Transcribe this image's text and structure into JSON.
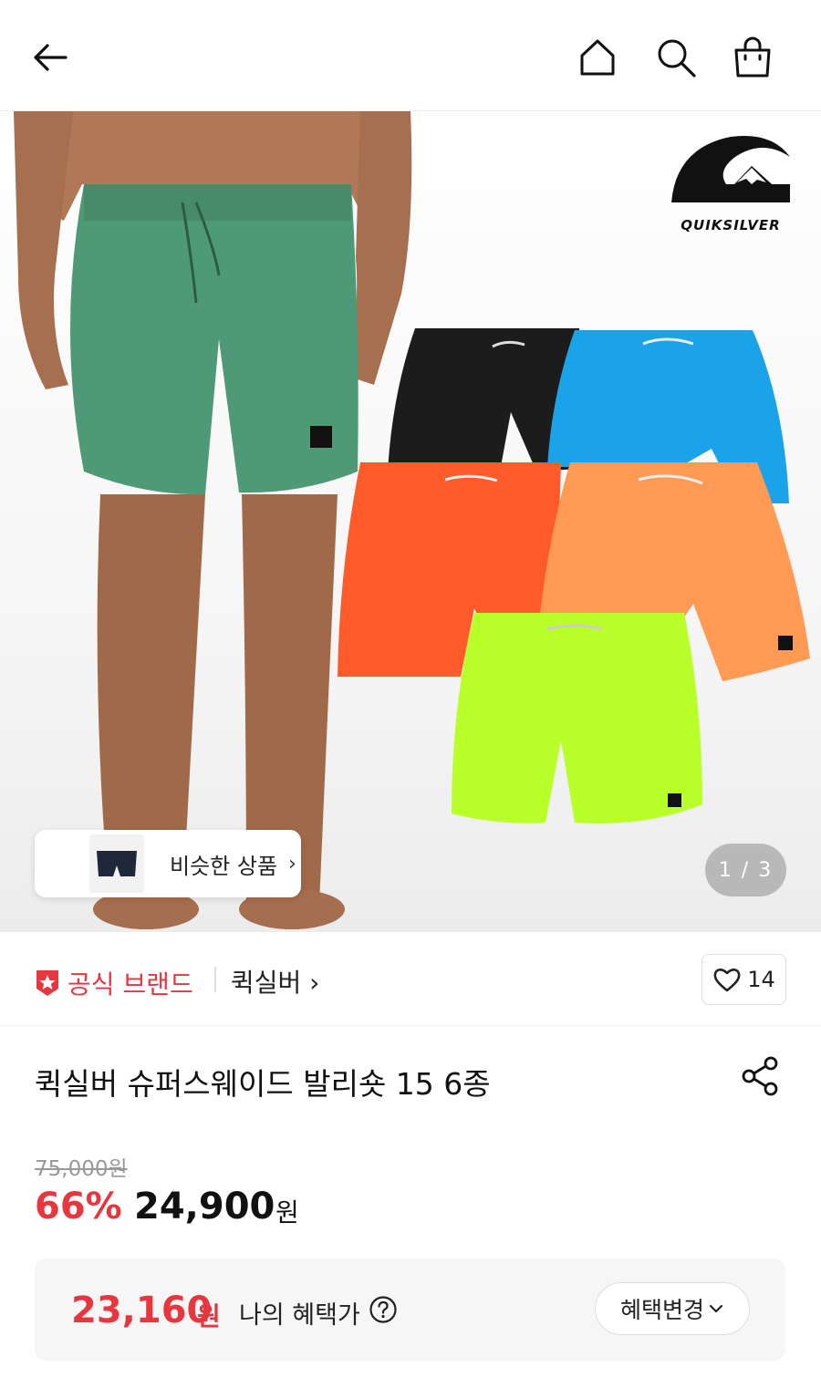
{
  "header": {
    "icons": [
      "back-arrow-icon",
      "home-icon",
      "search-icon",
      "shopping-bag-icon"
    ]
  },
  "hero": {
    "brand_logo_text": "QUIKSILVER",
    "similar_products_label": "비슷한 상품",
    "page_counter": "1 / 3",
    "shorts_colors": [
      "#4f9a76",
      "#1c1c1c",
      "#1aa3e8",
      "#ff5a2a",
      "#ff9a55",
      "#b9ff2a"
    ]
  },
  "brand_row": {
    "official_label": "공식 브랜드",
    "brand_name": "퀵실버 ›",
    "like_count": "14"
  },
  "product": {
    "title": "퀵실버 슈퍼스웨이드 발리숏 15 6종",
    "original_price": "75,000원",
    "discount_rate": "66%",
    "price": "24,900",
    "price_unit": "원"
  },
  "benefit": {
    "price": "23,160",
    "unit": "원",
    "label": "나의 혜택가",
    "change_button": "혜택변경"
  },
  "colors": {
    "accent_red": "#e8363e",
    "benefit_bg": "#f6f6f6"
  }
}
